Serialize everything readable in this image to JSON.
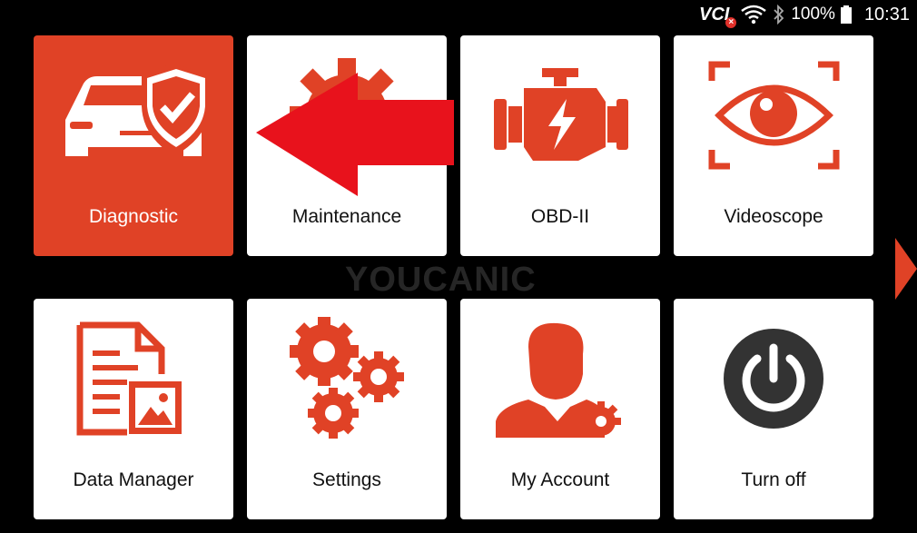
{
  "status_bar": {
    "vci_label": "VCI",
    "battery": "100%",
    "time": "10:31"
  },
  "watermark": "YOUCANIC",
  "tiles": [
    {
      "label": "Diagnostic"
    },
    {
      "label": "Maintenance"
    },
    {
      "label": "OBD-II"
    },
    {
      "label": "Videoscope"
    },
    {
      "label": "Data Manager"
    },
    {
      "label": "Settings"
    },
    {
      "label": "My Account"
    },
    {
      "label": "Turn off"
    }
  ],
  "colors": {
    "accent": "#e04226",
    "arrow": "#e8121c",
    "background": "#000000"
  }
}
